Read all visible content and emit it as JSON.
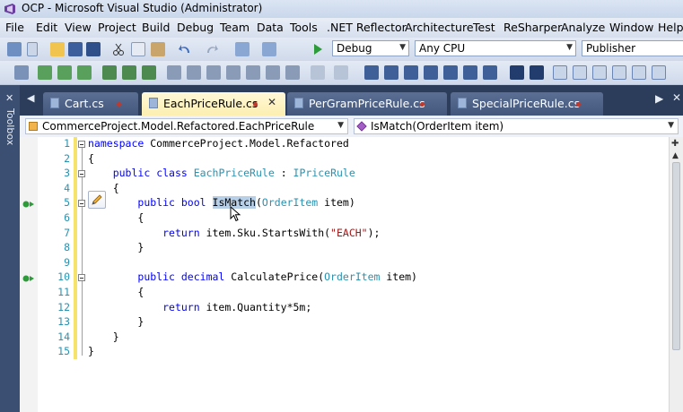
{
  "window": {
    "title": "OCP - Microsoft Visual Studio (Administrator)"
  },
  "menu": [
    "File",
    "Edit",
    "View",
    "Project",
    "Build",
    "Debug",
    "Team",
    "Data",
    "Tools",
    ".NET Reflector",
    "Architecture",
    "Test",
    "ReSharper",
    "Analyze",
    "Window",
    "Help"
  ],
  "toolbar": {
    "configuration": "Debug",
    "platform": "Any CPU",
    "search": "Publisher"
  },
  "toolbox": {
    "label": "Toolbox"
  },
  "tabs": [
    {
      "label": "Cart.cs",
      "active": false,
      "unsaved": true
    },
    {
      "label": "EachPriceRule.cs",
      "active": true,
      "unsaved": true
    },
    {
      "label": "PerGramPriceRule.cs",
      "active": false,
      "unsaved": true
    },
    {
      "label": "SpecialPriceRule.cs",
      "active": false,
      "unsaved": true
    }
  ],
  "navigation": {
    "type_combo": "CommerceProject.Model.Refactored.EachPriceRule",
    "member_combo": "IsMatch(OrderItem item)"
  },
  "editor": {
    "line_numbers": [
      "1",
      "2",
      "3",
      "4",
      "5",
      "6",
      "7",
      "8",
      "9",
      "10",
      "11",
      "12",
      "13",
      "14",
      "15"
    ],
    "code": {
      "l1_kw": "namespace",
      "l1_rest": " CommerceProject.Model.Refactored",
      "l2": "{",
      "l3_kw1": "public",
      "l3_kw2": "class",
      "l3_name": "EachPriceRule",
      "l3_colon": " : ",
      "l3_iface": "IPriceRule",
      "l4": "{",
      "l5_kw1": "public",
      "l5_kw2": "bool",
      "l5_method": "IsMatch",
      "l5_open": "(",
      "l5_type": "OrderItem",
      "l5_rest": " item)",
      "l6": "{",
      "l7_kw": "return",
      "l7_mid": " item.Sku.StartsWith(",
      "l7_str": "\"EACH\"",
      "l7_end": ");",
      "l8": "}",
      "l10_kw1": "public",
      "l10_kw2": "decimal",
      "l10_method": " CalculatePrice(",
      "l10_type": "OrderItem",
      "l10_rest": " item)",
      "l11": "{",
      "l12_kw": "return",
      "l12_rest": " item.Quantity*5m;",
      "l13": "}",
      "l14": "}",
      "l15": "}"
    }
  },
  "colors": {
    "keyword": "#0000ff",
    "type": "#2b91af",
    "string": "#a31515",
    "active_tab": "#fcefb0",
    "change_bar": "#f5e36b",
    "selection": "#b8cfe8"
  },
  "icons": [
    "save-icon",
    "open-icon",
    "cut-icon",
    "copy-icon",
    "paste-icon",
    "undo-icon",
    "redo-icon",
    "start-debug-icon",
    "implementation-icon",
    "edit-pencil-icon",
    "mouse-cursor-icon"
  ]
}
